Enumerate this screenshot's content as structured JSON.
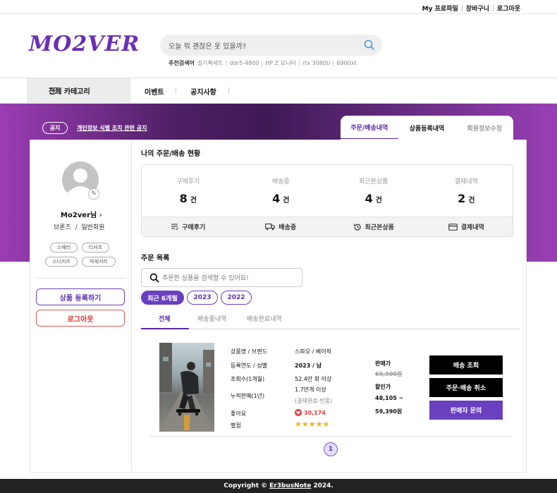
{
  "top_links": [
    "My 프로파일",
    "장바구니",
    "로그아웃"
  ],
  "logo": "MO2VER",
  "search": {
    "placeholder": "오늘 뭐 괜찮은 옷 있을까?"
  },
  "recommend": {
    "label": "추천검색어",
    "items": [
      "설기획세트",
      "ddr5-4800",
      "HP Z 모니터",
      "rtx 3080ti",
      "6900xt"
    ]
  },
  "nav": {
    "all_category": "전체 카테고리",
    "links": [
      "이벤트",
      "공지사항"
    ]
  },
  "notice": {
    "badge": "공지",
    "text": "개인정보 식별 조치 관련 공지"
  },
  "tabs": [
    "주문/배송내역",
    "상품등록내역",
    "회원정보수정"
  ],
  "user": {
    "name": "Mo2ver님",
    "grade": "브론즈",
    "level": "일반회원",
    "tags": [
      "스웨터",
      "티셔츠",
      "스니커즈",
      "악세서리"
    ]
  },
  "side_buttons": {
    "register": "상품 등록하기",
    "logout": "로그아웃"
  },
  "status_title": "나의 주문/배송 현황",
  "summary": [
    {
      "label": "구매후기",
      "value": "8",
      "unit": "건",
      "link": "구매후기"
    },
    {
      "label": "배송중",
      "value": "4",
      "unit": "건",
      "link": "배송중"
    },
    {
      "label": "최근본상품",
      "value": "4",
      "unit": "건",
      "link": "최근본상품"
    },
    {
      "label": "결제내역",
      "value": "2",
      "unit": "건",
      "link": "결제내역"
    }
  ],
  "orders_title": "주문 목록",
  "order_search": {
    "placeholder": "주문한 상품을 검색할 수 있어요!"
  },
  "periods": [
    "최근 6개월",
    "2023",
    "2022"
  ],
  "order_tabs": [
    "전체",
    "배송중내역",
    "배송완료내역"
  ],
  "product": {
    "labels": [
      "상품명 / 브랜드",
      "등록연도 / 성별",
      "조회수(1개월)",
      "누적판매(1년)",
      "좋아요",
      "별점"
    ],
    "values": {
      "name": "스파오 / 베이직",
      "year": "2023 / 남",
      "views": "52.4만 회 이상",
      "sales": "1.7만개 이상",
      "sales_note": "(결제완료-반품)",
      "likes": "30,174",
      "stars": "★★★★★"
    },
    "price_label": "판매가",
    "price": "69,900원",
    "discount_label": "할인가",
    "discount_from": "48,105 ~",
    "discount_to": "59,390원",
    "buttons": [
      "배송 조회",
      "주문·배송 취소",
      "판매자 문의"
    ]
  },
  "page": "1",
  "footer": {
    "prefix": "Copyright ©",
    "name": "Er3busNote",
    "suffix": "2024."
  },
  "colors": {
    "brand": "#6a2fb5",
    "accent": "#6a3fc0",
    "danger": "#d33333"
  }
}
